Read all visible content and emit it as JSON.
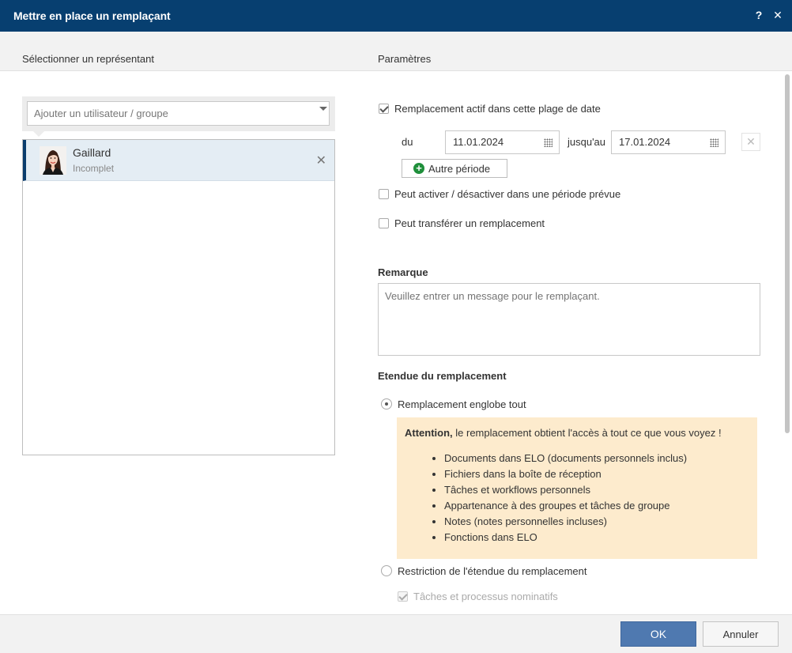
{
  "dialog": {
    "title": "Mettre en place un remplaçant",
    "help_label": "?",
    "close_label": "✕"
  },
  "left": {
    "header": "Sélectionner un représentant",
    "search_placeholder": "Ajouter un utilisateur / groupe",
    "users": [
      {
        "name": "Gaillard",
        "status": "Incomplet",
        "remove_label": "✕"
      }
    ]
  },
  "right": {
    "header": "Paramètres",
    "active_range": {
      "label": "Remplacement actif dans cette plage de date",
      "checked": true
    },
    "from_label": "du",
    "from_value": "11.01.2024",
    "to_label": "jusqu'au",
    "to_value": "17.01.2024",
    "clear_label": "✕",
    "other_period_label": "Autre période",
    "can_toggle": {
      "label": "Peut activer / désactiver dans une période prévue",
      "checked": false
    },
    "can_transfer": {
      "label": "Peut transférer un remplacement",
      "checked": false
    },
    "remark_title": "Remarque",
    "remark_placeholder": "Veuillez entrer un message pour le remplaçant.",
    "scope_title": "Etendue du remplacement",
    "scope_all": {
      "label": "Remplacement englobe tout",
      "selected": true
    },
    "warning": {
      "strong": "Attention,",
      "text": " le remplacement obtient l'accès à tout ce que vous voyez !",
      "items": [
        "Documents dans ELO (documents personnels inclus)",
        "Fichiers dans la boîte de réception",
        "Tâches et workflows personnels",
        "Appartenance à des groupes et tâches de groupe",
        "Notes (notes personnelles incluses)",
        "Fonctions dans ELO"
      ]
    },
    "scope_restricted": {
      "label": "Restriction de l'étendue du remplacement",
      "selected": false
    },
    "tasks_nominative": {
      "label": "Tâches et processus nominatifs",
      "checked": true,
      "disabled": true
    }
  },
  "footer": {
    "ok_label": "OK",
    "cancel_label": "Annuler"
  },
  "colors": {
    "titlebar": "#073f70",
    "ok_button": "#4f79b0",
    "selected_row": "#e4edf4",
    "warning_bg": "#fdebcd",
    "plus_icon": "#1f8f3b"
  }
}
